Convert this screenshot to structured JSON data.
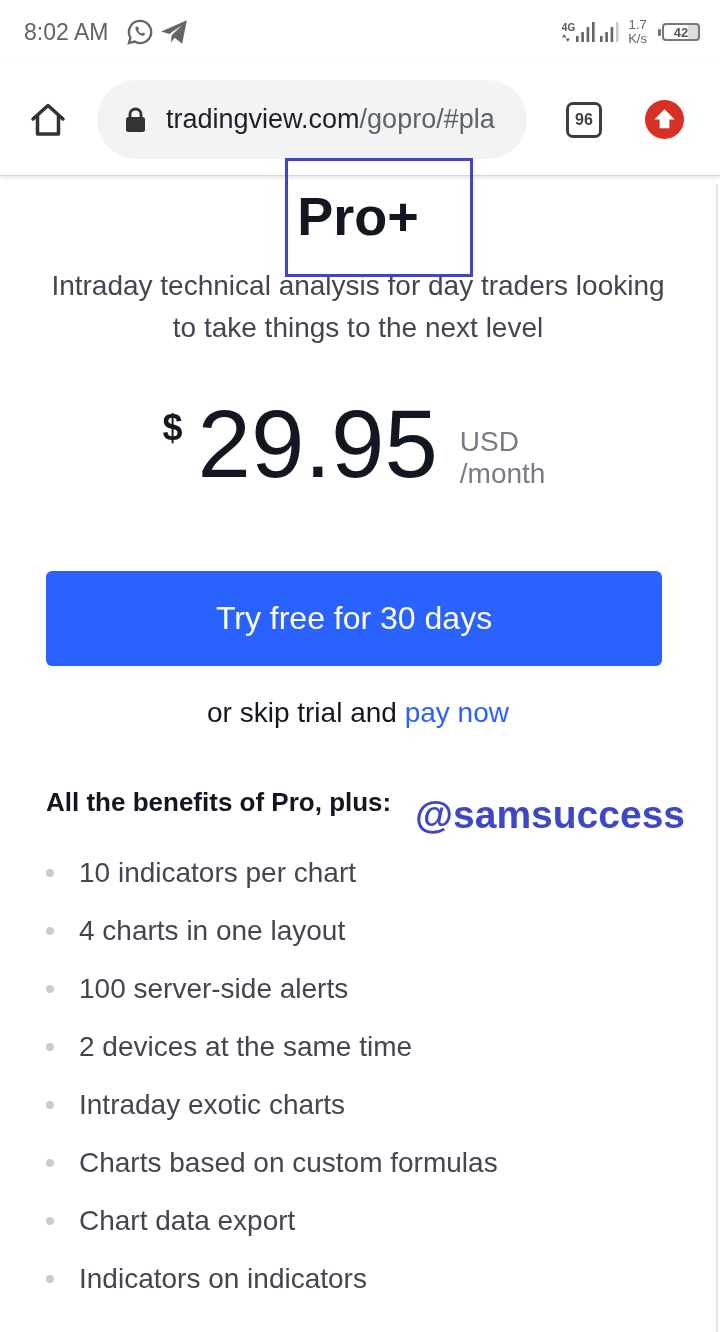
{
  "status_bar": {
    "time": "8:02 AM",
    "network_label": "4G",
    "speed": "1.7",
    "speed_unit": "K/s",
    "battery": "42"
  },
  "browser_bar": {
    "url_domain": "tradingview.com",
    "url_path": "/gopro/#pla",
    "tab_count": "96"
  },
  "plan": {
    "name": "Pro+",
    "name_highlighted": true,
    "description": "Intraday technical analysis for day traders looking to take things to the next level",
    "currency_symbol": "$",
    "price": "29.95",
    "currency": "USD",
    "period": "/month",
    "trial_button": "Try free for 30 days",
    "skip_text": "or skip trial and",
    "pay_link": "pay now",
    "benefits_heading": "All the benefits of Pro, plus:",
    "benefits": [
      "10 indicators per chart",
      "4 charts in one layout",
      "100 server-side alerts",
      "2 devices at the same time",
      "Intraday exotic charts",
      "Charts based on custom formulas",
      "Chart data export",
      "Indicators on indicators"
    ]
  },
  "overlay_text": "@samsuccess"
}
